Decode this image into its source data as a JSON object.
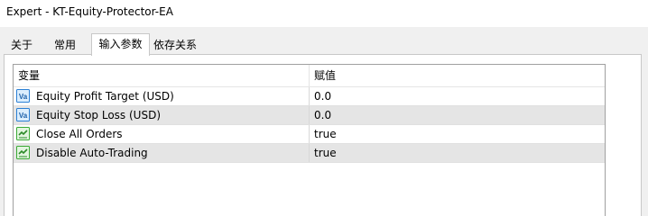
{
  "window": {
    "title": "Expert - KT-Equity-Protector-EA"
  },
  "tabs": [
    {
      "label": "关于",
      "active": false
    },
    {
      "label": "常用",
      "active": false
    },
    {
      "label": "输入参数",
      "active": true
    },
    {
      "label": "依存关系",
      "active": false
    }
  ],
  "grid": {
    "columns": [
      "变量",
      "赋值"
    ],
    "rows": [
      {
        "icon": "number-value-icon",
        "name": "Equity Profit Target (USD)",
        "value": "0.0"
      },
      {
        "icon": "number-value-icon",
        "name": "Equity Stop Loss (USD)",
        "value": "0.0"
      },
      {
        "icon": "boolean-value-icon",
        "name": "Close All Orders",
        "value": "true"
      },
      {
        "icon": "boolean-value-icon",
        "name": "Disable Auto-Trading",
        "value": "true"
      }
    ]
  },
  "colors": {
    "alt_row": "#e5e5e5",
    "number_icon": "#2a7fd4",
    "boolean_icon": "#3aaa35"
  }
}
